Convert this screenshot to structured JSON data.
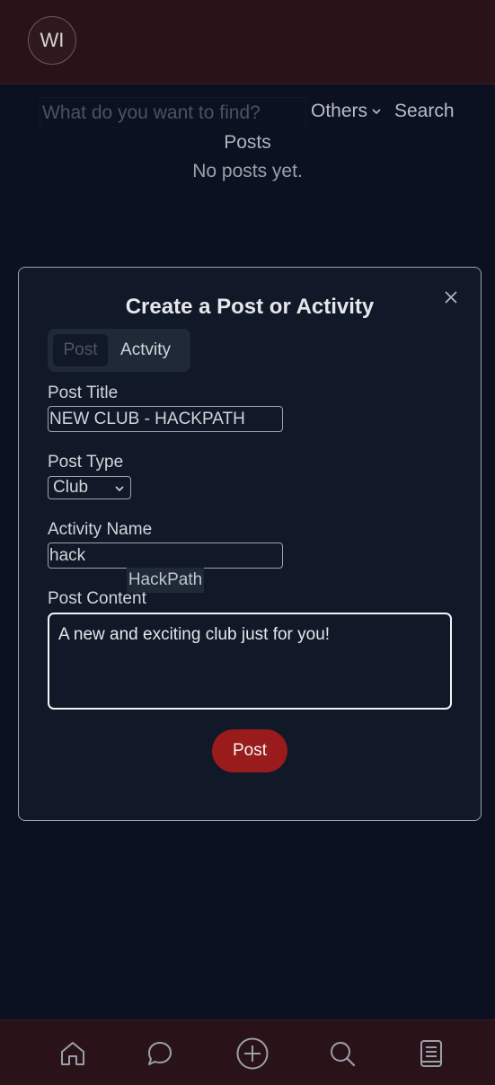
{
  "header": {
    "avatar_initials": "WI"
  },
  "search": {
    "placeholder": "What do you want to find?",
    "value": "",
    "filter_label": "Others",
    "button_label": "Search"
  },
  "feed": {
    "heading": "Posts",
    "empty_message": "No posts yet."
  },
  "modal": {
    "title": "Create a Post or Activity",
    "tabs": [
      {
        "label": "Post",
        "active": false
      },
      {
        "label": "Actvity",
        "active": true
      }
    ],
    "post_title_label": "Post Title",
    "post_title_value": "NEW CLUB - HACKPATH",
    "post_type_label": "Post Type",
    "post_type_value": "Club",
    "activity_name_label": "Activity Name",
    "activity_name_value": "hack",
    "activity_suggestion": "HackPath",
    "post_content_label": "Post Content",
    "post_content_value": "A new and exciting club just for you!",
    "submit_label": "Post"
  },
  "bottom_nav": {
    "items": [
      "home-icon",
      "chat-icon",
      "add-icon",
      "search-icon",
      "book-icon"
    ]
  },
  "colors": {
    "background": "#0b1120",
    "bars": "#2a1318",
    "modal": "#111827",
    "accent": "#991b1b"
  }
}
